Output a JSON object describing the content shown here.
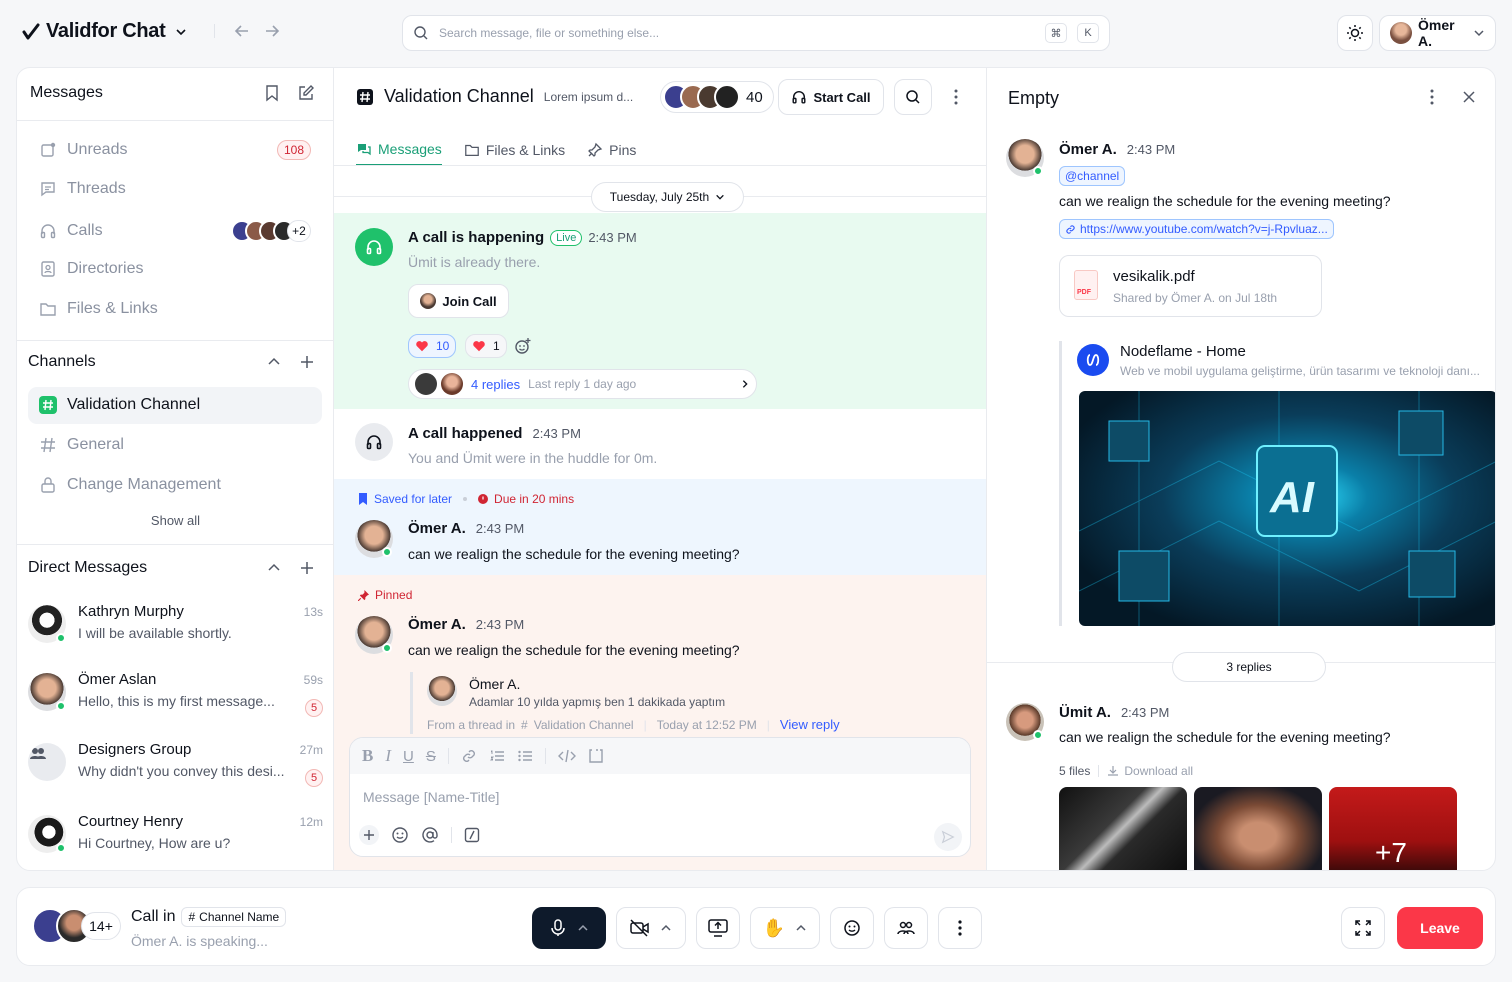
{
  "app": {
    "name": "Validfor Chat"
  },
  "search": {
    "placeholder": "Search message, file or something else...",
    "kbd1": "⌘",
    "kbd2": "K"
  },
  "user": {
    "name": "Ömer A."
  },
  "sidebar": {
    "title": "Messages",
    "nav": [
      {
        "label": "Unreads",
        "badge": "108",
        "icon": "unread-icon"
      },
      {
        "label": "Threads",
        "icon": "threads-icon"
      },
      {
        "label": "Calls",
        "extra": "+2",
        "icon": "headphones-icon"
      },
      {
        "label": "Directories",
        "icon": "directory-icon"
      },
      {
        "label": "Files & Links",
        "icon": "folder-icon"
      }
    ],
    "channels_title": "Channels",
    "channels": [
      {
        "label": "Validation Channel",
        "active": true
      },
      {
        "label": "General"
      },
      {
        "label": "Change Management",
        "locked": true
      }
    ],
    "show_all": "Show all",
    "dms_title": "Direct Messages",
    "dms": [
      {
        "name": "Kathryn Murphy",
        "msg": "I will be available shortly.",
        "time": "13s",
        "count": ""
      },
      {
        "name": "Ömer Aslan",
        "msg": "Hello, this is my first message...",
        "time": "59s",
        "count": "5"
      },
      {
        "name": "Designers Group",
        "msg": "Why didn't you convey this desi...",
        "time": "27m",
        "count": "5"
      },
      {
        "name": "Courtney Henry",
        "msg": "Hi Courtney, How are u?",
        "time": "12m",
        "count": ""
      }
    ]
  },
  "channel": {
    "title": "Validation Channel",
    "desc": "Lorem ipsum d...",
    "member_count": "40",
    "start_call": "Start Call",
    "tabs": [
      "Messages",
      "Files & Links",
      "Pins"
    ],
    "date": "Tuesday, July 25th"
  },
  "messages": {
    "call": {
      "title": "A call is happening",
      "live": "Live",
      "time": "2:43 PM",
      "sub": "Ümit is already there.",
      "join": "Join Call",
      "r1": "10",
      "r2": "1",
      "replies": "4 replies",
      "last": "Last reply 1 day ago"
    },
    "call2": {
      "title": "A call happened",
      "time": "2:43 PM",
      "sub": "You and Ümit were in the huddle for 0m."
    },
    "saved": {
      "label": "Saved for later",
      "due": "Due in 20 mins",
      "name": "Ömer A.",
      "time": "2:43 PM",
      "text": "can we realign the schedule for the evening meeting?"
    },
    "pinned": {
      "label": "Pinned",
      "name": "Ömer A.",
      "time": "2:43 PM",
      "text": "can we realign the schedule for the evening meeting?",
      "quote_name": "Ömer A.",
      "quote_text": "Adamlar 10 yılda yapmış ben 1 dakikada yaptım",
      "from": "From a thread in",
      "chan": "Validation Channel",
      "when": "Today at 12:52 PM",
      "view": "View reply"
    }
  },
  "composer": {
    "placeholder": "Message [Name-Title]"
  },
  "panel": {
    "title": "Empty",
    "m1": {
      "name": "Ömer A.",
      "time": "2:43 PM",
      "mention": "@channel",
      "text": "can we realign the schedule for the evening meeting?",
      "link": "https://www.youtube.com/watch?v=j-Rpvluaz...",
      "file_name": "vesikalik.pdf",
      "file_sub": "Shared by Ömer A. on Jul 18th",
      "file_tag": "PDF",
      "preview_title": "Nodeflame - Home",
      "preview_desc": "Web ve mobil uygulama geliştirme, ürün tasarımı ve teknoloji danı...",
      "image_text": "AI"
    },
    "replies": "3 replies",
    "m2": {
      "name": "Ümit A.",
      "time": "2:43 PM",
      "text": "can we realign the schedule for the evening meeting?",
      "files": "5 files",
      "download": "Download all",
      "more": "+7"
    }
  },
  "callbar": {
    "count": "14+",
    "title": "Call in",
    "channel": "Channel Name",
    "speaking": "Ömer A. is speaking...",
    "leave": "Leave"
  },
  "colors": {
    "accent": "#1a9f77",
    "danger": "#fb3748",
    "live_bg": "#e8faf0",
    "saved_bg": "#eef6fe",
    "pinned_bg": "#fdf3ef"
  }
}
